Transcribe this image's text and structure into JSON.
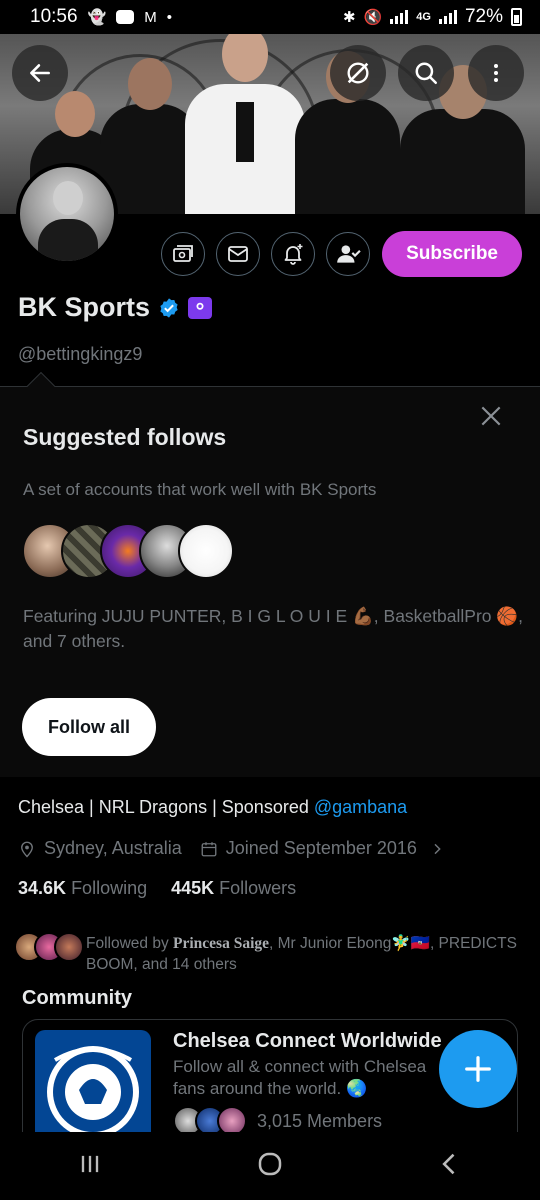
{
  "status_bar": {
    "time": "10:56",
    "network": "4G",
    "battery": "72%"
  },
  "header": {
    "back_icon": "arrow-left-icon",
    "grok_icon": "grok-icon",
    "search_icon": "search-icon",
    "more_icon": "more-vertical-icon"
  },
  "profile": {
    "name": "BK Sports",
    "affiliate_badge_label": "Gambana",
    "handle": "@bettingkingz9",
    "subscribe_label": "Subscribe",
    "bio_text": "Chelsea | NRL Dragons | Sponsored ",
    "bio_mention": "@gambana",
    "location": "Sydney, Australia",
    "joined": "Joined September 2016",
    "following_count": "34.6K",
    "following_label": "Following",
    "followers_count": "445K",
    "followers_label": "Followers",
    "followed_by_prefix": "Followed by ",
    "followed_by_name": "Princesa Saige",
    "followed_by_rest": ", Mr Junior Ebong🧚‍♂️🇭🇹, PREDICTS BOOM, and 14 others"
  },
  "suggested": {
    "title": "Suggested follows",
    "subtitle": "A set of accounts that work well with BK Sports",
    "featuring": "Featuring JUJU PUNTER, B I G L O U I E 💪🏾, BasketballPro 🏀, and 7 others.",
    "follow_all_label": "Follow all"
  },
  "community": {
    "section_title": "Community",
    "name": "Chelsea Connect Worldwide",
    "description": "Follow all & connect with Chelsea fans around the world. 🌏",
    "members": "3,015 Members"
  },
  "colors": {
    "accent": "#1d9bf0",
    "subscribe": "#c93fd8",
    "muted": "#71767b"
  }
}
